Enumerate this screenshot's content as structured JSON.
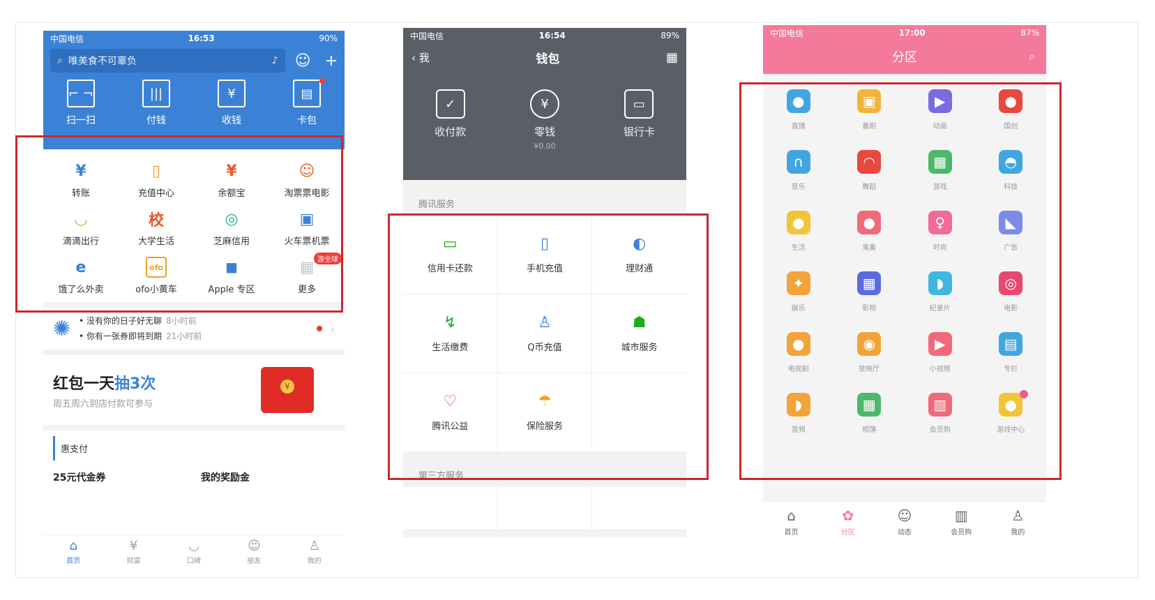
{
  "phone_a": {
    "status": {
      "carrier": "中国电信",
      "time": "16:53",
      "battery": "90%"
    },
    "search_placeholder": "唯美食不可辜负",
    "top_actions": [
      {
        "label": "扫一扫",
        "icon": "scan-icon"
      },
      {
        "label": "付钱",
        "icon": "barcode-icon"
      },
      {
        "label": "收钱",
        "icon": "yuan-receive-icon"
      },
      {
        "label": "卡包",
        "icon": "card-wallet-icon"
      }
    ],
    "grid": [
      {
        "label": "转账",
        "icon": "transfer-icon",
        "glyph": "¥",
        "color": "#3b82d6"
      },
      {
        "label": "充值中心",
        "icon": "phone-topup-icon",
        "glyph": "▯",
        "color": "#f0a020"
      },
      {
        "label": "余额宝",
        "icon": "money-bag-icon",
        "glyph": "¥",
        "color": "#e8572a"
      },
      {
        "label": "淘票票电影",
        "icon": "movie-icon",
        "glyph": "☺",
        "color": "#e8572a"
      },
      {
        "label": "滴滴出行",
        "icon": "didi-icon",
        "glyph": "◡",
        "color": "#f0a020"
      },
      {
        "label": "大学生活",
        "icon": "school-icon",
        "glyph": "校",
        "color": "#e8572a"
      },
      {
        "label": "芝麻信用",
        "icon": "sesame-credit-icon",
        "glyph": "◎",
        "color": "#2bb08a"
      },
      {
        "label": "火车票机票",
        "icon": "train-ticket-icon",
        "glyph": "▣",
        "color": "#3b82d6"
      },
      {
        "label": "饿了么外卖",
        "icon": "eleme-icon",
        "glyph": "e",
        "color": "#3b82d6"
      },
      {
        "label": "ofo小黄车",
        "icon": "ofo-icon",
        "glyph": "ofo",
        "color": "#f0a020"
      },
      {
        "label": "Apple 专区",
        "icon": "apple-icon",
        "glyph": "◼",
        "color": "#3b82d6"
      },
      {
        "label": "更多",
        "icon": "more-grid-icon",
        "glyph": "▦",
        "color": "#c9c9c9",
        "badge": "游全球"
      }
    ],
    "notices": [
      {
        "text": "没有你的日子好无聊",
        "time": "8小时前"
      },
      {
        "text": "你有一张券即将到期",
        "time": "21小时前"
      }
    ],
    "banner": {
      "title_prefix": "红包一天",
      "title_highlight": "抽3次",
      "subtitle": "周五周六到店付款可参与"
    },
    "section_title": "惠支付",
    "promos": [
      "25元代金券",
      "我的奖励金"
    ],
    "tabs": [
      {
        "label": "首页",
        "icon": "home-icon",
        "active": true
      },
      {
        "label": "财富",
        "icon": "wealth-icon"
      },
      {
        "label": "口碑",
        "icon": "koubei-icon"
      },
      {
        "label": "朋友",
        "icon": "friends-icon"
      },
      {
        "label": "我的",
        "icon": "profile-icon"
      }
    ]
  },
  "phone_b": {
    "status": {
      "carrier": "中国电信",
      "time": "16:54",
      "battery": "89%"
    },
    "back_label": "我",
    "title": "钱包",
    "wallet_items": [
      {
        "label": "收付款",
        "icon": "pay-receive-icon",
        "glyph": "✓"
      },
      {
        "label": "零钱",
        "icon": "change-icon",
        "glyph": "¥",
        "sub": "¥0.00"
      },
      {
        "label": "银行卡",
        "icon": "bank-card-icon",
        "glyph": "▭"
      }
    ],
    "section_tencent": "腾讯服务",
    "services": [
      {
        "label": "信用卡还款",
        "icon": "credit-card-icon",
        "glyph": "▭",
        "tone": ""
      },
      {
        "label": "手机充值",
        "icon": "mobile-topup-icon",
        "glyph": "▯",
        "tone": "blue"
      },
      {
        "label": "理财通",
        "icon": "wealth-manage-icon",
        "glyph": "◐",
        "tone": "blue"
      },
      {
        "label": "生活缴费",
        "icon": "utility-bill-icon",
        "glyph": "↯",
        "tone": ""
      },
      {
        "label": "Q币充值",
        "icon": "qq-coin-icon",
        "glyph": "♙",
        "tone": "blue"
      },
      {
        "label": "城市服务",
        "icon": "city-service-icon",
        "glyph": "☗",
        "tone": ""
      },
      {
        "label": "腾讯公益",
        "icon": "charity-heart-icon",
        "glyph": "♡",
        "tone": "red"
      },
      {
        "label": "保险服务",
        "icon": "insurance-umbrella-icon",
        "glyph": "☂",
        "tone": "orange"
      },
      {
        "label": "",
        "icon": "",
        "glyph": "",
        "tone": ""
      }
    ],
    "section_third": "第三方服务"
  },
  "phone_c": {
    "status": {
      "carrier": "中国电信",
      "time": "17:00",
      "battery": "87%"
    },
    "title": "分区",
    "categories": [
      {
        "label": "直播",
        "icon": "live-camera-icon",
        "glyph": "●",
        "color": "#41a6e0"
      },
      {
        "label": "番剧",
        "icon": "tv-icon",
        "glyph": "▣",
        "color": "#f2b43a"
      },
      {
        "label": "动画",
        "icon": "animation-icon",
        "glyph": "▶",
        "color": "#7a6be0"
      },
      {
        "label": "国创",
        "icon": "guochuang-icon",
        "glyph": "●",
        "color": "#e8483e"
      },
      {
        "label": "音乐",
        "icon": "headphone-icon",
        "glyph": "∩",
        "color": "#41a6e0"
      },
      {
        "label": "舞蹈",
        "icon": "fan-icon",
        "glyph": "◠",
        "color": "#e8483e"
      },
      {
        "label": "游戏",
        "icon": "game-icon",
        "glyph": "▦",
        "color": "#4cb86a"
      },
      {
        "label": "科技",
        "icon": "ufo-icon",
        "glyph": "◓",
        "color": "#41a6e0"
      },
      {
        "label": "生活",
        "icon": "duck-icon",
        "glyph": "●",
        "color": "#f2c43a"
      },
      {
        "label": "鬼畜",
        "icon": "monkey-icon",
        "glyph": "●",
        "color": "#f06a7a"
      },
      {
        "label": "时尚",
        "icon": "dress-icon",
        "glyph": "♀",
        "color": "#f06a9a"
      },
      {
        "label": "广告",
        "icon": "megaphone-icon",
        "glyph": "◣",
        "color": "#7a8be8"
      },
      {
        "label": "娱乐",
        "icon": "magic-wand-icon",
        "glyph": "✦",
        "color": "#f2a43a"
      },
      {
        "label": "影视",
        "icon": "film-icon",
        "glyph": "▦",
        "color": "#5a6be0"
      },
      {
        "label": "纪录片",
        "icon": "dolphin-icon",
        "glyph": "◗",
        "color": "#41b6e0"
      },
      {
        "label": "电影",
        "icon": "3d-glasses-icon",
        "glyph": "◎",
        "color": "#e84870"
      },
      {
        "label": "电视剧",
        "icon": "tv-series-icon",
        "glyph": "●",
        "color": "#f2a43a"
      },
      {
        "label": "放映厅",
        "icon": "film-reel-icon",
        "glyph": "◉",
        "color": "#f2a43a"
      },
      {
        "label": "小视频",
        "icon": "video-clip-icon",
        "glyph": "▶",
        "color": "#f06a7a"
      },
      {
        "label": "专栏",
        "icon": "column-icon",
        "glyph": "▤",
        "color": "#41a6e0"
      },
      {
        "label": "音频",
        "icon": "audio-icon",
        "glyph": "◗",
        "color": "#f2a43a"
      },
      {
        "label": "相簿",
        "icon": "album-icon",
        "glyph": "▦",
        "color": "#4cb86a"
      },
      {
        "label": "会员购",
        "icon": "shopping-bag-icon",
        "glyph": "▥",
        "color": "#f06a7a"
      },
      {
        "label": "游戏中心",
        "icon": "game-center-icon",
        "glyph": "●",
        "color": "#f2c43a",
        "badge": true
      }
    ],
    "tabs": [
      {
        "label": "首页",
        "icon": "home-icon"
      },
      {
        "label": "分区",
        "icon": "category-icon",
        "active": true
      },
      {
        "label": "动态",
        "icon": "feed-icon"
      },
      {
        "label": "会员购",
        "icon": "store-icon"
      },
      {
        "label": "我的",
        "icon": "profile-icon"
      }
    ]
  },
  "colors": {
    "highlight_box": "#c9282e",
    "alipay_blue": "#3b82d6",
    "wechat_gray": "#5a5f67",
    "bili_pink": "#f47a9b"
  }
}
